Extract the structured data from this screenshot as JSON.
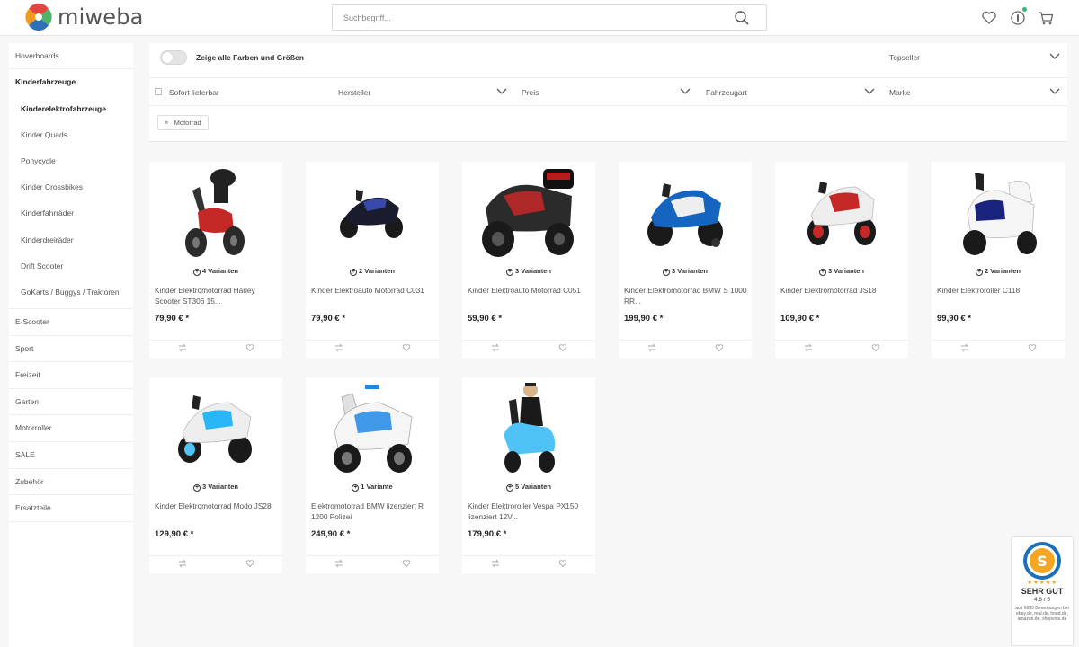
{
  "header": {
    "logo_text": "miweba",
    "search_placeholder": "Suchbegriff...",
    "icons": [
      "heart-icon",
      "account-icon",
      "cart-icon"
    ]
  },
  "sidebar": {
    "top": [
      {
        "label": "Hoverboards"
      }
    ],
    "active_category": {
      "label": "Kinderfahrzeuge"
    },
    "subcategories": [
      {
        "label": "Kinderelektrofahrzeuge",
        "active": true
      },
      {
        "label": "Kinder Quads"
      },
      {
        "label": "Ponycycle"
      },
      {
        "label": "Kinder Crossbikes"
      },
      {
        "label": "Kinderfahrräder"
      },
      {
        "label": "Kinderdreiräder"
      },
      {
        "label": "Drift Scooter"
      },
      {
        "label": "GoKarts / Buggys / Traktoren"
      }
    ],
    "bottom": [
      {
        "label": "E-Scooter"
      },
      {
        "label": "Sport"
      },
      {
        "label": "Freizeit"
      },
      {
        "label": "Garten"
      },
      {
        "label": "Motorroller"
      },
      {
        "label": "SALE"
      },
      {
        "label": "Zubehör"
      },
      {
        "label": "Ersatzteile"
      }
    ]
  },
  "filters": {
    "toggle_label": "Zeige alle Farben und Größen",
    "sort_label": "Topseller",
    "items": [
      {
        "label": "Sofort lieferbar"
      },
      {
        "label": "Hersteller"
      },
      {
        "label": "Preis"
      },
      {
        "label": "Fahrzeugart"
      },
      {
        "label": "Marke"
      }
    ],
    "active_filter": {
      "close": "×",
      "label": "Motorrad"
    }
  },
  "products": [
    {
      "variants": "4 Varianten",
      "name": "Kinder Elektromotorrad Harley Scooter ST306 15...",
      "price": "79,90 € *"
    },
    {
      "variants": "2 Varianten",
      "name": "Kinder Elektroauto Motorrad C031",
      "price": "79,90 € *"
    },
    {
      "variants": "3 Varianten",
      "name": "Kinder Elektroauto Motorrad C051",
      "price": "59,90 € *"
    },
    {
      "variants": "3 Varianten",
      "name": "Kinder Elektromotorrad BMW S 1000 RR...",
      "price": "199,90 € *"
    },
    {
      "variants": "3 Varianten",
      "name": "Kinder Elektromotorrad JS18",
      "price": "109,90 € *"
    },
    {
      "variants": "2 Varianten",
      "name": "Kinder Elektroroller C118",
      "price": "99,90 € *"
    },
    {
      "variants": "3 Varianten",
      "name": "Kinder Elektromotorrad Modo JS28",
      "price": "129,90 € *"
    },
    {
      "variants": "1 Variante",
      "name": "Elektromotorrad BMW lizenziert R 1200 Polizei",
      "price": "249,90 € *"
    },
    {
      "variants": "5 Varianten",
      "name": "Kinder Elektroroller Vespa PX150 lizenziert 12V...",
      "price": "179,90 € *"
    }
  ],
  "trust_badge": {
    "seal_letter": "S",
    "stars": "★★★★★",
    "rating": "SEHR GUT",
    "score": "4.8 / 5",
    "details": "aus 6633 Bewertungen bei ebay.de, real.de, hood.de, amazon.de, shopvote.de"
  },
  "colors": {
    "logo_red": "#e2443f",
    "logo_orange": "#f29c1f",
    "logo_green": "#4fb36a",
    "logo_blue": "#2e6fb8",
    "accent_green": "#38b27a"
  }
}
